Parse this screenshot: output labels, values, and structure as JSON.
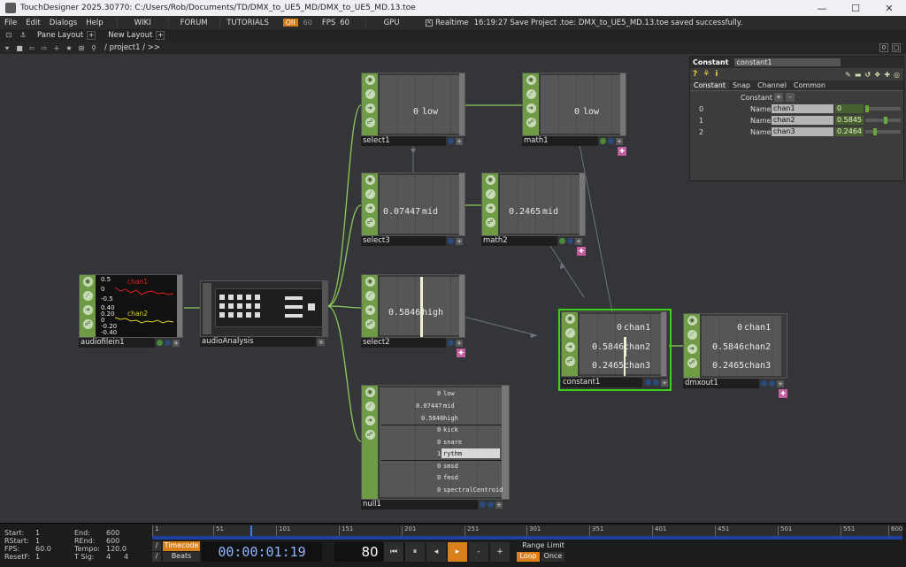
{
  "window": {
    "title": "TouchDesigner 2025.30770: C:/Users/Rob/Documents/TD/DMX_to_UE5_MD/DMX_to_UE5_MD.13.toe",
    "minimize": "—",
    "maximize": "☐",
    "close": "✕"
  },
  "menubar": {
    "items": [
      "File",
      "Edit",
      "Dialogs",
      "Help"
    ],
    "tabs": [
      "WIKI",
      "FORUM",
      "TUTORIALS"
    ],
    "oi_badge": "OII",
    "oi_value": "60",
    "fps_label": "FPS",
    "fps_value": "60",
    "gpu_label": "GPU",
    "realtime_label": "Realtime",
    "status_message": "16:19:27 Save Project .toe: DMX_to_UE5_MD.13.toe saved successfully."
  },
  "panebar": {
    "pane_layout": "Pane Layout",
    "new_layout": "New Layout",
    "plus": "+"
  },
  "pathbar": {
    "path": "/ project1 / >>",
    "right_value": "0"
  },
  "nodes": {
    "select1": {
      "label": "select1",
      "value": "0",
      "channel": "low"
    },
    "math1": {
      "label": "math1",
      "value": "0",
      "channel": "low"
    },
    "select3": {
      "label": "select3",
      "value": "0.07447",
      "channel": "mid"
    },
    "math2": {
      "label": "math2",
      "value": "0.2465",
      "channel": "mid"
    },
    "select2": {
      "label": "select2",
      "value": "0.5846",
      "channel": "high"
    },
    "audiofilein1": {
      "label": "audiofilein1",
      "chan1": "chan1",
      "chan2": "chan2",
      "ticks": [
        "0.5",
        "0",
        "-0.5",
        "0.40",
        "0.20",
        "0",
        "-0.20",
        "-0.40"
      ]
    },
    "audioAnalysis": {
      "label": "audioAnalysis"
    },
    "constant1": {
      "label": "constant1",
      "rows": [
        {
          "value": "0",
          "name": "chan1"
        },
        {
          "value": "0.5846",
          "name": "chan2"
        },
        {
          "value": "0.2465",
          "name": "chan3"
        }
      ]
    },
    "dmxout1": {
      "label": "dmxout1",
      "rows": [
        {
          "value": "0",
          "name": "chan1"
        },
        {
          "value": "0.5846",
          "name": "chan2"
        },
        {
          "value": "0.2465",
          "name": "chan3"
        }
      ]
    },
    "null1": {
      "label": "null1",
      "rows": [
        {
          "value": "0",
          "name": "low"
        },
        {
          "value": "0.07447",
          "name": "mid"
        },
        {
          "value": "0.5846",
          "name": "high"
        },
        {
          "value": "0",
          "name": "kick"
        },
        {
          "value": "0",
          "name": "snare"
        },
        {
          "value": "1",
          "name": "rythm"
        },
        {
          "value": "0",
          "name": "smsd"
        },
        {
          "value": "0",
          "name": "fmsd"
        },
        {
          "value": "0",
          "name": "spectralCentroid"
        }
      ]
    }
  },
  "param": {
    "type": "Constant",
    "name": "constant1",
    "tabs": [
      "Constant",
      "Snap",
      "Channel",
      "Common"
    ],
    "section_label": "Constant",
    "name_label": "Name",
    "rows": [
      {
        "index": "0",
        "name": "chan1",
        "value": "0",
        "level": 0
      },
      {
        "index": "1",
        "name": "chan2",
        "value": "0.5845",
        "level": 0.5845
      },
      {
        "index": "2",
        "name": "chan3",
        "value": "0.2464",
        "level": 0.2464
      }
    ]
  },
  "timeline": {
    "start_label": "Start:",
    "start": "1",
    "rstart_label": "RStart:",
    "rstart": "1",
    "fps_label": "FPS:",
    "fps": "60.0",
    "resetf_label": "ResetF:",
    "resetf": "1",
    "end_label": "End:",
    "end": "600",
    "rend_label": "REnd:",
    "rend": "600",
    "tempo_label": "Tempo:",
    "tempo": "120.0",
    "tsig_label": "T Sig:",
    "tsig_a": "4",
    "tsig_b": "4",
    "ruler_ticks": [
      "1",
      "51",
      "101",
      "151",
      "201",
      "251",
      "301",
      "351",
      "401",
      "451",
      "501",
      "551",
      "600"
    ],
    "timecode_label": "Timecode",
    "beats_label": "Beats",
    "timecode": "00:00:01:19",
    "frame": "80",
    "range_limit": "Range Limit",
    "loop": "Loop",
    "once": "Once"
  }
}
